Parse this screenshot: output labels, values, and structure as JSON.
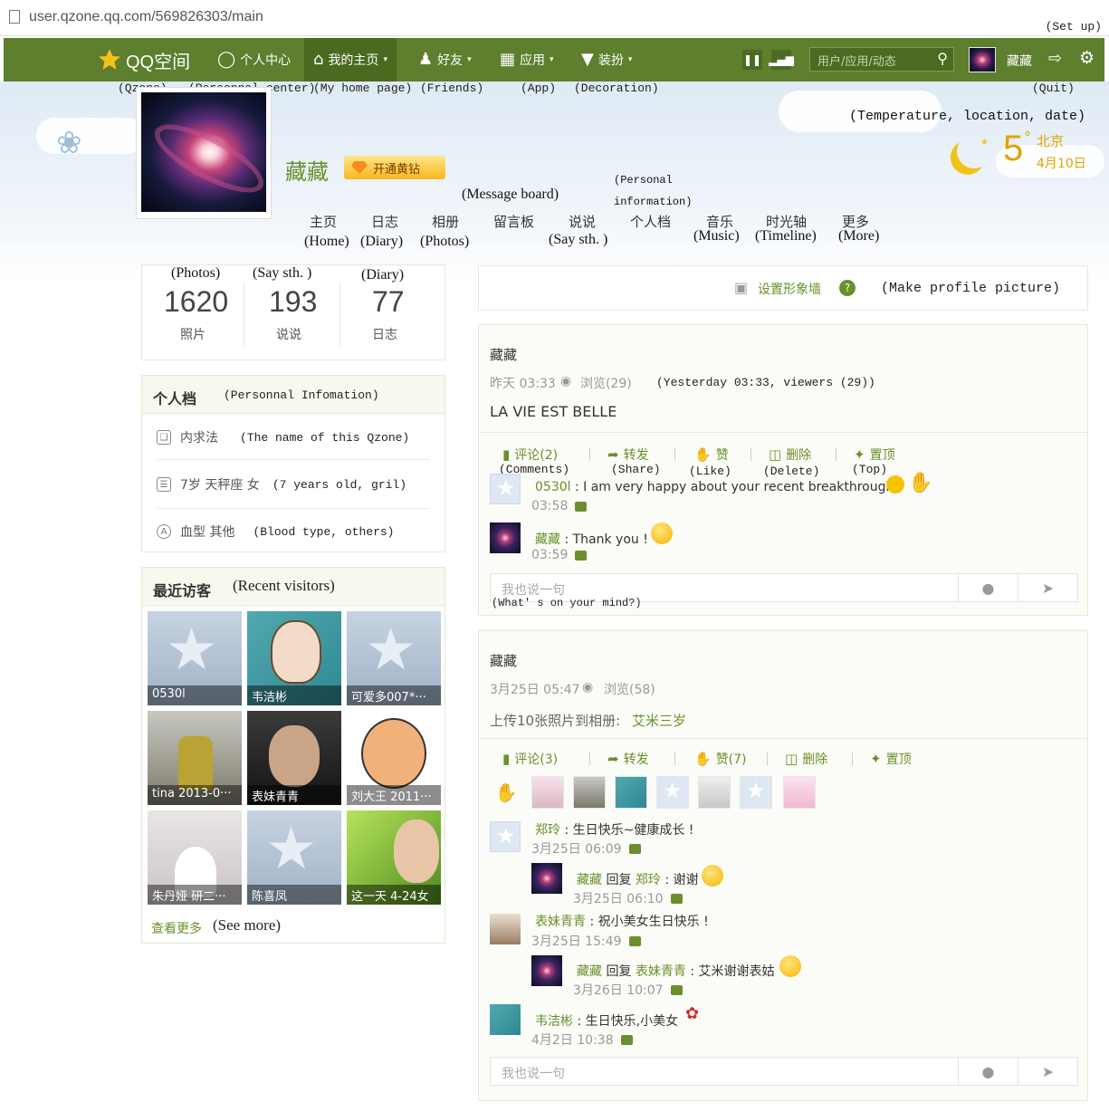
{
  "browser": {
    "url": "user.qzone.qq.com/569826303/main",
    "setup_note": "(Set up)"
  },
  "nav": {
    "brand": "QQ空间",
    "items": [
      "个人中心",
      "我的主页",
      "好友",
      "应用",
      "装扮"
    ],
    "search_placeholder": "用户/应用/动态",
    "user": "藏藏",
    "annotations": {
      "qzone": "(Qzone)",
      "personal_center": "(Personnal center)",
      "my_home": "(My home page)",
      "friends": "(Friends)",
      "app": "(App)",
      "decoration": "(Decoration)",
      "quit": "(Quit)"
    }
  },
  "profile": {
    "name": "藏藏",
    "vip_label": "开通黄钻"
  },
  "subnav": {
    "items": [
      "主页",
      "日志",
      "相册",
      "留言板",
      "说说",
      "个人档",
      "音乐",
      "时光轴",
      "更多"
    ],
    "annotations": {
      "home": "(Home)",
      "diary": "(Diary)",
      "photos": "(Photos)",
      "message_board": "(Message board)",
      "personal_info_1": "(Personal",
      "personal_info_2": "information)",
      "say": "(Say sth. )",
      "music": "(Music)",
      "timeline": "(Timeline)",
      "more": "(More)"
    }
  },
  "weather": {
    "annotation": "(Temperature, location, date)",
    "temp": "5",
    "degree": "°",
    "city": "北京",
    "date": "4月10日"
  },
  "stats": {
    "annotations": [
      "(Photos)",
      "(Say sth. )",
      "(Diary)"
    ],
    "items": [
      {
        "value": "1620",
        "label": "照片"
      },
      {
        "value": "193",
        "label": "说说"
      },
      {
        "value": "77",
        "label": "日志"
      }
    ]
  },
  "personal_info": {
    "title": "个人档",
    "title_anno": "(Personnal Infomation)",
    "rows": [
      {
        "text": "内求法",
        "anno": "(The name of this Qzone)"
      },
      {
        "text": "7岁 天秤座 女",
        "anno": "(7 years old, gril)"
      },
      {
        "text": "血型 其他",
        "anno": "(Blood type, others)"
      }
    ]
  },
  "visitors": {
    "title": "最近访客",
    "title_anno": "(Recent visitors)",
    "items": [
      "0530l",
      "韦洁彬",
      "可爱多007*···",
      "tina 2013-0···",
      "表妹青青",
      "刘大王 2011···",
      "朱丹娅 研二···",
      "陈喜凤",
      "这一天 4-24女"
    ],
    "see_more": "查看更多",
    "see_more_anno": "(See more)"
  },
  "make_profile": {
    "label": "设置形象墙",
    "anno": "(Make profile picture)"
  },
  "post1": {
    "author": "藏藏",
    "time": "昨天 03:33",
    "views": "浏览(29)",
    "meta_anno": "(Yesterday 03:33, viewers (29))",
    "content": "LA VIE EST BELLE",
    "actions": [
      "评论(2)",
      "转发",
      "赞",
      "删除",
      "置顶"
    ],
    "action_annos": [
      "(Comments)",
      "(Share)",
      "(Like)",
      "(Delete)",
      "(Top)"
    ],
    "comments": [
      {
        "user": "0530l",
        "text": " : I am very happy about your recent breakthrough.",
        "time": "03:58"
      },
      {
        "user": "藏藏",
        "text": " : Thank you !",
        "time": "03:59"
      }
    ],
    "reply_placeholder": "我也说一句",
    "reply_anno": "(What' s on your mind?)"
  },
  "post2": {
    "author": "藏藏",
    "time": "3月25日 05:47",
    "views": "浏览(58)",
    "content_prefix": "上传10张照片到相册:",
    "album": "艾米三岁",
    "actions": [
      "评论(3)",
      "转发",
      "赞(7)",
      "删除",
      "置顶"
    ],
    "comments": [
      {
        "user": "郑玲",
        "text": " : 生日快乐~健康成长 !",
        "time": "3月25日 06:09"
      },
      {
        "user": "藏藏",
        "reply_word": " 回复 ",
        "target": "郑玲",
        "text": " : 谢谢",
        "time": "3月25日 06:10"
      },
      {
        "user": "表妹青青",
        "text": " : 祝小美女生日快乐 !",
        "time": "3月25日 15:49"
      },
      {
        "user": "藏藏",
        "reply_word": " 回复 ",
        "target": "表妹青青",
        "text": " : 艾米谢谢表姑",
        "time": "3月26日 10:07"
      },
      {
        "user": "韦洁彬",
        "text": " : 生日快乐,小美女",
        "time": "4月2日 10:38"
      }
    ],
    "reply_placeholder": "我也说一句"
  },
  "colors": {
    "nav_bg": "#5d7f2e",
    "accent_green": "#6a8f2c",
    "link_green": "#6a8f2c"
  }
}
